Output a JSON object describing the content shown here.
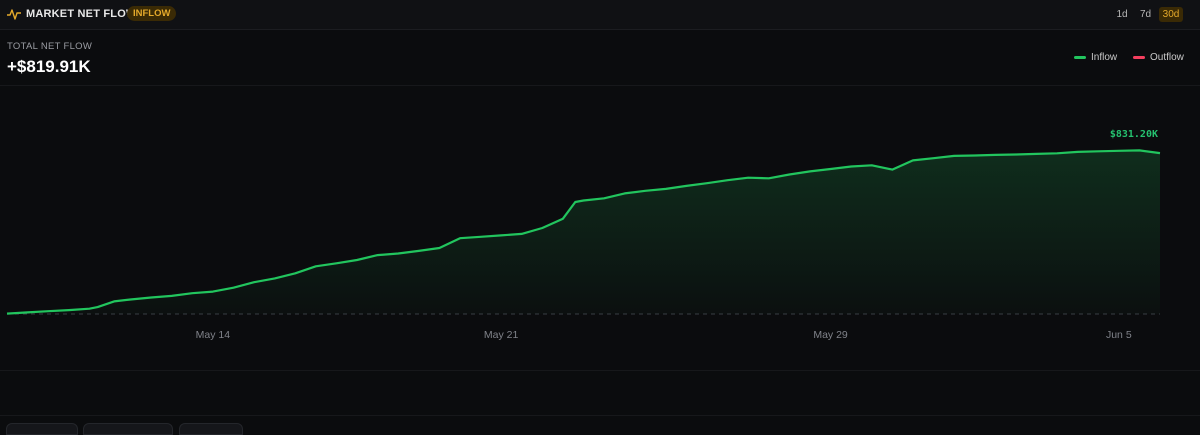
{
  "header": {
    "title": "MARKET NET FLOW",
    "badge": "INFLOW",
    "ranges": [
      "1d",
      "7d",
      "30d"
    ],
    "active_range": "30d"
  },
  "summary": {
    "label": "TOTAL NET FLOW",
    "value": "+$819.91K"
  },
  "legend": [
    {
      "label": "Inflow",
      "color": "#22c55e"
    },
    {
      "label": "Outflow",
      "color": "#f43f5e"
    }
  ],
  "chart_data": {
    "type": "area",
    "x_ticks": [
      "May 14",
      "May 21",
      "May 29",
      "Jun 5"
    ],
    "x_tick_days": [
      13,
      20,
      28,
      35
    ],
    "xlim": [
      8,
      36
    ],
    "ylim": [
      0,
      900
    ],
    "end_label": "$831.20K",
    "series": [
      {
        "color": "#22c55e",
        "x": [
          8.0,
          8.5,
          9.0,
          9.5,
          10.0,
          10.2,
          10.6,
          11.0,
          11.5,
          12.0,
          12.5,
          13.0,
          13.5,
          14.0,
          14.5,
          15.0,
          15.5,
          16.0,
          16.5,
          17.0,
          17.5,
          18.0,
          18.5,
          19.0,
          19.5,
          20.0,
          20.5,
          21.0,
          21.5,
          21.8,
          22.0,
          22.5,
          23.0,
          23.5,
          24.0,
          24.5,
          25.0,
          25.5,
          26.0,
          26.5,
          27.0,
          27.5,
          28.0,
          28.5,
          29.0,
          29.5,
          30.0,
          30.5,
          31.0,
          31.5,
          32.0,
          32.5,
          33.0,
          33.5,
          34.0,
          34.5,
          35.0,
          35.5,
          36.0
        ],
        "y": [
          2,
          8,
          14,
          20,
          27,
          35,
          64,
          74,
          84,
          92,
          106,
          114,
          134,
          162,
          181,
          207,
          243,
          258,
          275,
          300,
          308,
          321,
          336,
          386,
          393,
          400,
          408,
          438,
          485,
          570,
          578,
          589,
          614,
          627,
          637,
          652,
          666,
          681,
          694,
          691,
          710,
          726,
          738,
          751,
          757,
          735,
          782,
          793,
          805,
          807,
          810,
          812,
          815,
          818,
          825,
          828,
          831,
          833,
          819
        ]
      }
    ]
  }
}
